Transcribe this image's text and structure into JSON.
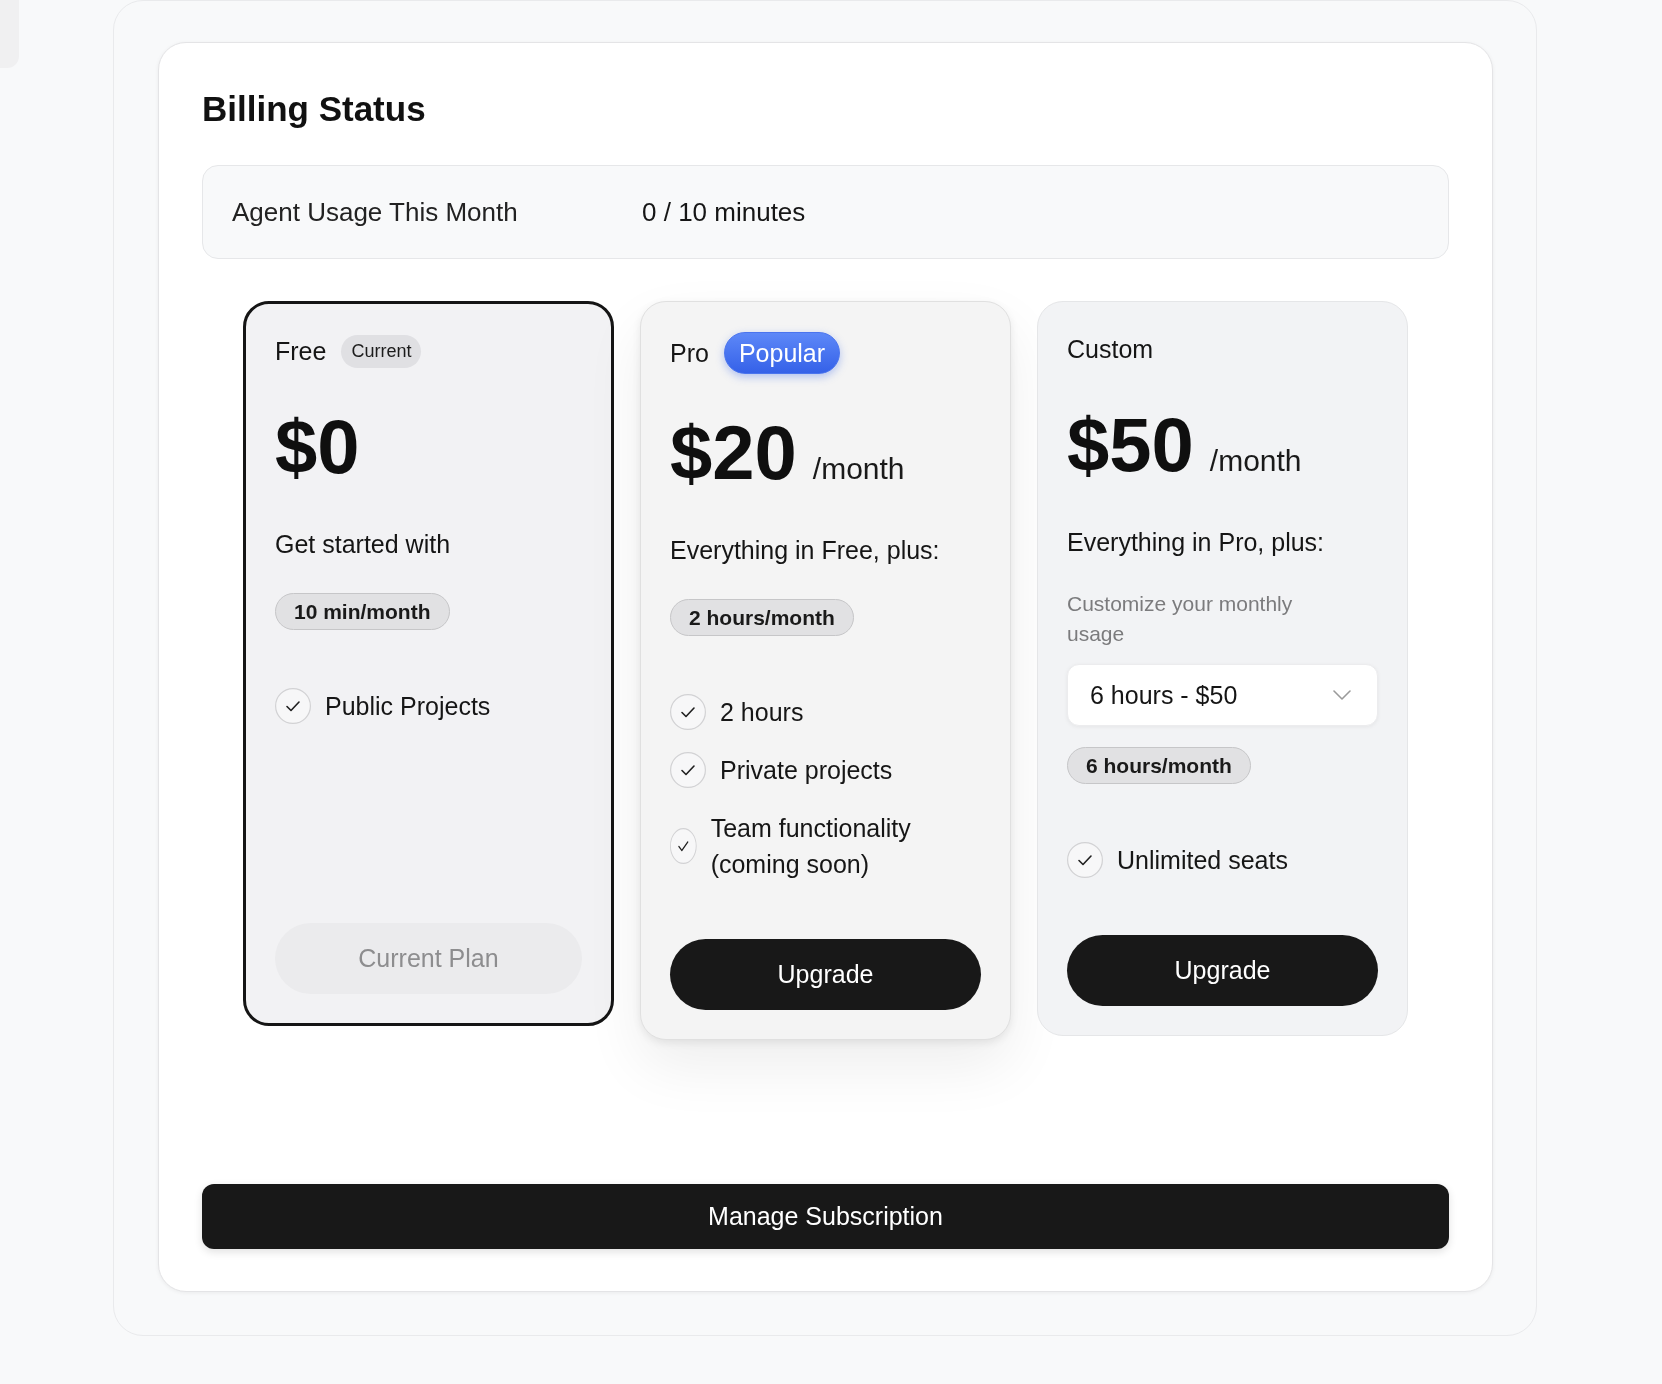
{
  "page": {
    "title": "Billing Status"
  },
  "usage": {
    "label": "Agent Usage This Month",
    "value": "0 / 10 minutes"
  },
  "plans": [
    {
      "name": "Free",
      "badge": {
        "kind": "current",
        "text": "Current"
      },
      "price": "$0",
      "description": "Get started with",
      "quota": "10 min/month",
      "features": [
        "Public Projects"
      ],
      "button": {
        "label": "Current Plan",
        "disabled": true
      },
      "selected": true,
      "featured": false
    },
    {
      "name": "Pro",
      "badge": {
        "kind": "popular",
        "text": "Popular"
      },
      "price": "$20",
      "period": "/month",
      "description": "Everything in Free, plus:",
      "quota": "2 hours/month",
      "features": [
        "2 hours",
        "Private projects",
        "Team functionality (coming soon)"
      ],
      "button": {
        "label": "Upgrade",
        "disabled": false
      },
      "selected": false,
      "featured": true
    },
    {
      "name": "Custom",
      "price": "$50",
      "period": "/month",
      "description": "Everything in Pro, plus:",
      "usage_select": {
        "label": "Customize your monthly usage",
        "value": "6 hours - $50"
      },
      "quota": "6 hours/month",
      "features": [
        "Unlimited seats"
      ],
      "button": {
        "label": "Upgrade",
        "disabled": false
      },
      "selected": false,
      "featured": false
    }
  ],
  "manage_button": {
    "label": "Manage Subscription"
  }
}
